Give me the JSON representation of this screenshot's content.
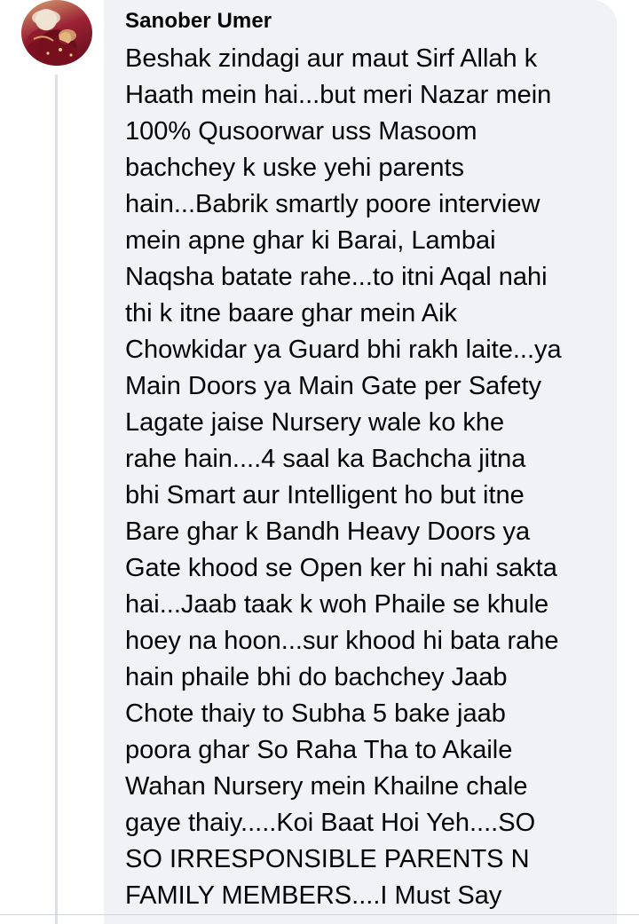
{
  "comment": {
    "author_name": "Sanober Umer",
    "avatar_icon": "profile-photo-avatar",
    "lines": [
      "Beshak zindagi aur maut Sirf Allah k",
      "Haath mein hai...but meri Nazar mein",
      "100% Qusoorwar uss Masoom",
      "bachchey k uske yehi parents",
      "hain...Babrik smartly poore interview",
      "mein apne ghar ki Barai, Lambai",
      "Naqsha batate rahe...to itni Aqal nahi",
      "thi k itne baare ghar mein Aik",
      "Chowkidar ya Guard bhi rakh laite...ya",
      "Main Doors ya Main Gate per Safety",
      "Lagate jaise Nursery wale ko khe",
      "rahe hain....4 saal ka Bachcha jitna",
      "bhi Smart aur Intelligent ho but itne",
      "Bare ghar k Bandh Heavy Doors ya",
      "Gate khood se Open ker hi nahi sakta",
      "hai...Jaab taak k woh Phaile se khule",
      "hoey na hoon...sur khood hi bata rahe",
      "hain phaile bhi do bachchey Jaab",
      "Chote thaiy to Subha 5 bake jaab",
      "poora ghar So Raha Tha to Akaile",
      "Wahan Nursery mein Khailne chale",
      "gaye thaiy.....Koi Baat Hoi Yeh....SO",
      "SO IRRESPONSIBLE PARENTS N",
      "FAMILY MEMBERS....I Must Say"
    ]
  },
  "colors": {
    "bubble_background": "#f0f2f5",
    "text": "#050505",
    "thread_line": "#dcdfe4"
  }
}
